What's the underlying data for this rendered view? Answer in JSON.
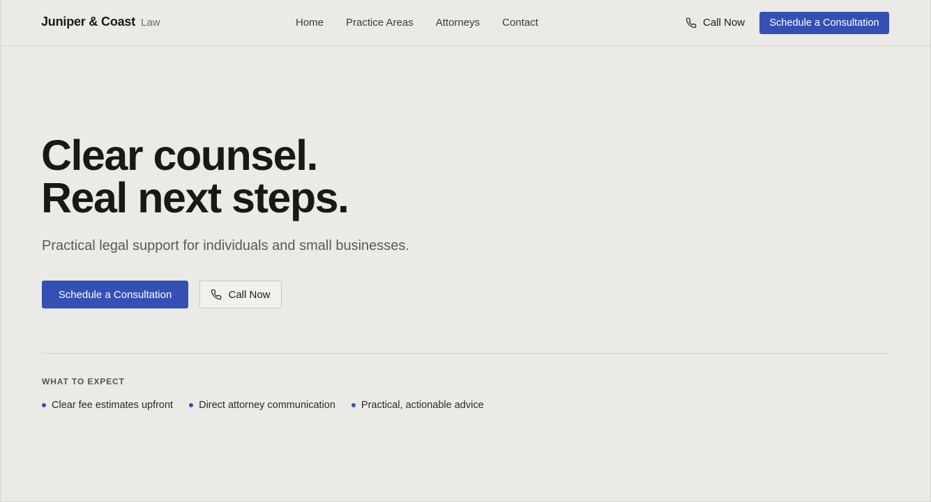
{
  "header": {
    "brand_name": "Juniper & Coast",
    "brand_suffix": "Law",
    "nav": [
      "Home",
      "Practice Areas",
      "Attorneys",
      "Contact"
    ],
    "call_label": "Call Now",
    "cta_label": "Schedule a Consultation"
  },
  "hero": {
    "title_line1": "Clear counsel.",
    "title_line2": "Real next steps.",
    "subtitle": "Practical legal support for individuals and small businesses.",
    "primary_label": "Schedule a Consultation",
    "secondary_label": "Call Now"
  },
  "expect": {
    "label": "WHAT TO EXPECT",
    "items": [
      "Clear fee estimates upfront",
      "Direct attorney communication",
      "Practical, actionable advice"
    ]
  },
  "colors": {
    "accent": "#3550B4",
    "background": "#ECEAE6",
    "text": "#1a1a18"
  },
  "icons": {
    "call": "phone-icon",
    "bullet": "bullet-dot-icon"
  }
}
